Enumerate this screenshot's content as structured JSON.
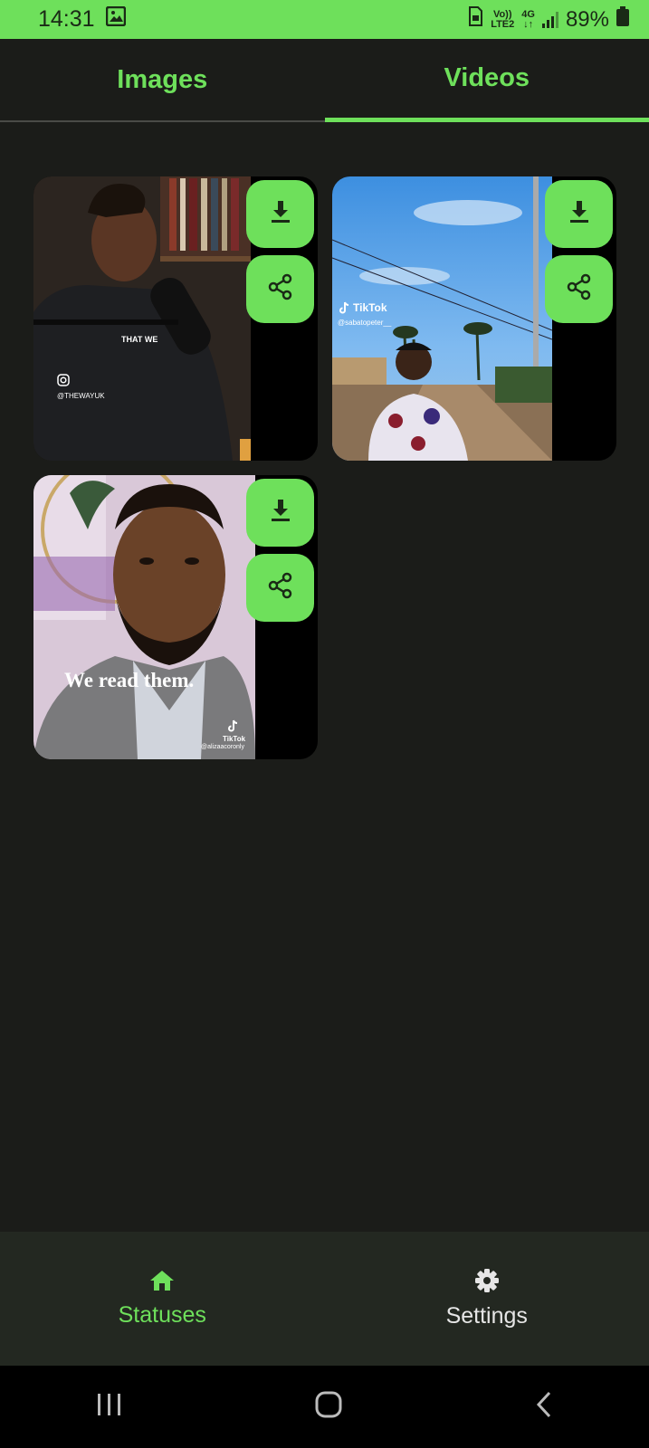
{
  "status_bar": {
    "time": "14:31",
    "volte_top": "Vo))",
    "volte_bottom": "LTE2",
    "network_top": "4G",
    "network_bottom": "↓↑",
    "battery": "89%"
  },
  "tabs": [
    {
      "label": "Images",
      "active": false
    },
    {
      "label": "Videos",
      "active": true
    }
  ],
  "videos": [
    {
      "overlay": "THAT WE",
      "handle": "@THEWAYUK",
      "icons": [
        "instagram-icon"
      ]
    },
    {
      "overlay": "TikTok",
      "handle": "@sabatopeter__",
      "icons": [
        "tiktok-icon"
      ]
    },
    {
      "overlay": "We read them.",
      "handle": "TikTok",
      "sub_handle": "@alizaacoronly",
      "icons": [
        "tiktok-icon"
      ]
    }
  ],
  "actions": {
    "download_icon": "download-icon",
    "share_icon": "share-icon"
  },
  "bottom_nav": {
    "items": [
      {
        "label": "Statuses",
        "icon": "home-icon",
        "active": true
      },
      {
        "label": "Settings",
        "icon": "gear-icon",
        "active": false
      }
    ]
  },
  "colors": {
    "accent": "#6ee05b",
    "background": "#1b1c19",
    "nav_background": "#232821"
  }
}
